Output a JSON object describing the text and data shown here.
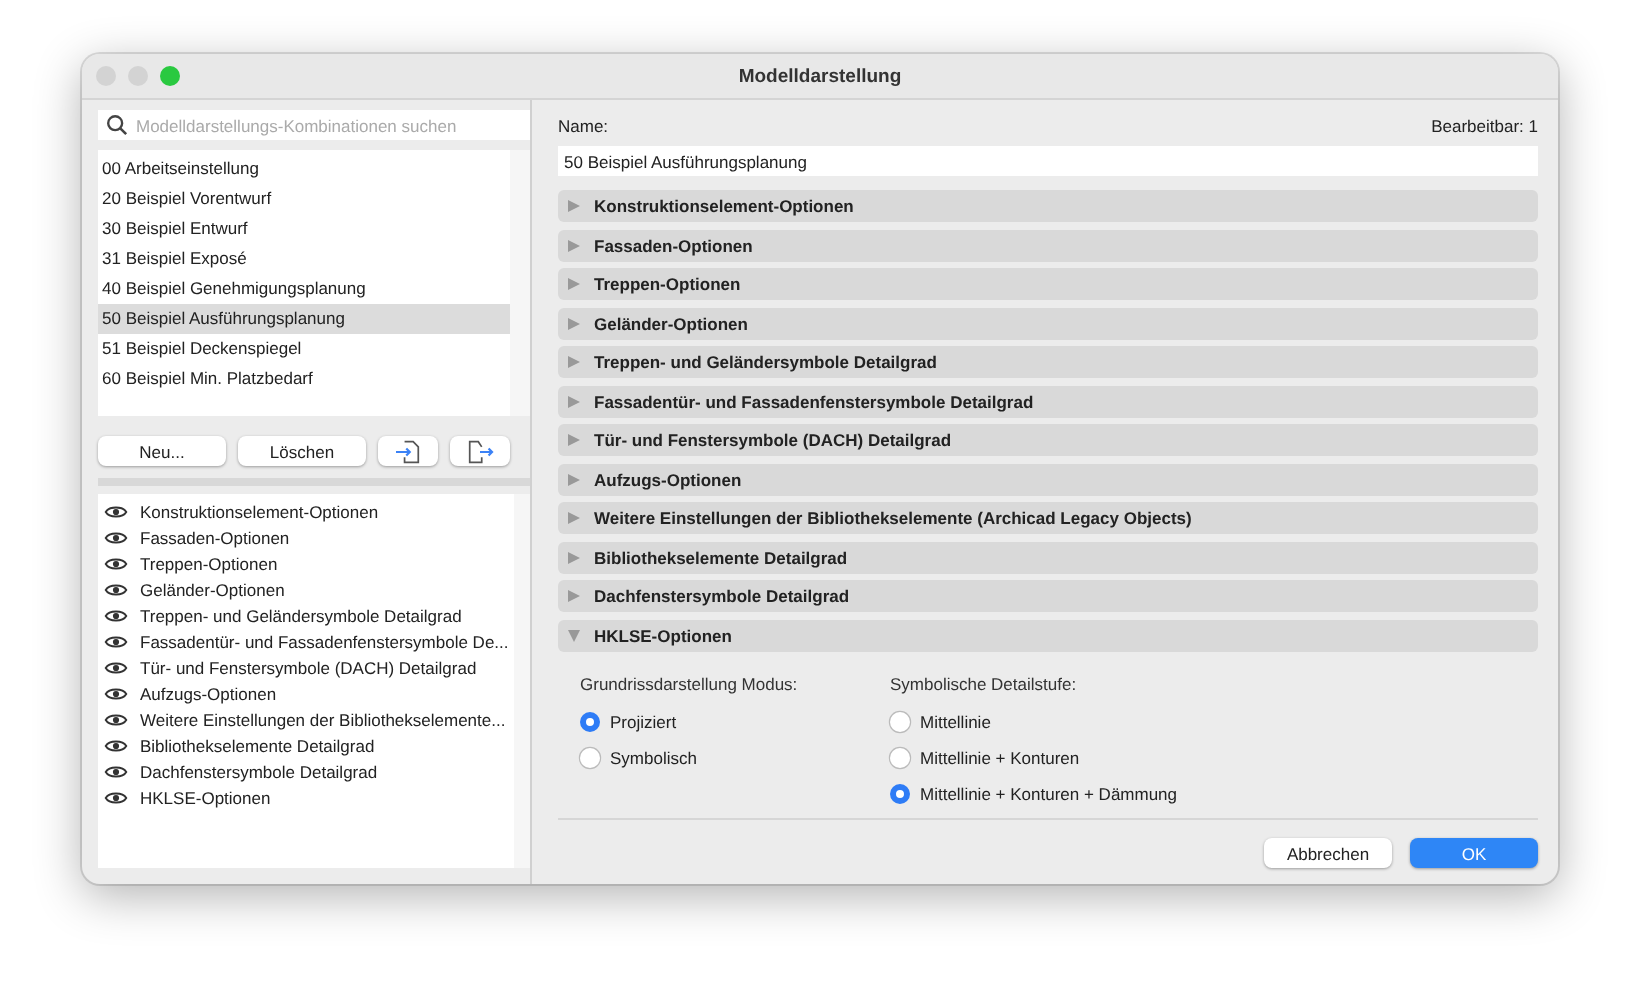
{
  "window": {
    "title": "Modelldarstellung"
  },
  "search": {
    "placeholder": "Modelldarstellungs-Kombinationen suchen"
  },
  "presets": [
    {
      "label": "00 Arbeitseinstellung",
      "selected": false
    },
    {
      "label": "20 Beispiel Vorentwurf",
      "selected": false
    },
    {
      "label": "30 Beispiel Entwurf",
      "selected": false
    },
    {
      "label": "31 Beispiel Exposé",
      "selected": false
    },
    {
      "label": "40 Beispiel Genehmigungsplanung",
      "selected": false
    },
    {
      "label": "50 Beispiel Ausführungsplanung",
      "selected": true
    },
    {
      "label": "51 Beispiel Deckenspiegel",
      "selected": false
    },
    {
      "label": "60 Beispiel Min. Platzbedarf",
      "selected": false
    }
  ],
  "preset_buttons": [
    "Neu...",
    "Löschen"
  ],
  "visible_options": [
    {
      "label": "Konstruktionselement-Optionen"
    },
    {
      "label": "Fassaden-Optionen"
    },
    {
      "label": "Treppen-Optionen"
    },
    {
      "label": "Geländer-Optionen"
    },
    {
      "label": "Treppen- und Geländersymbole Detailgrad"
    },
    {
      "label": "Fassadentür- und Fassadenfenstersymbole De..."
    },
    {
      "label": "Tür- und Fenstersymbole (DACH) Detailgrad"
    },
    {
      "label": "Aufzugs-Optionen"
    },
    {
      "label": "Weitere Einstellungen der Bibliothekselemente..."
    },
    {
      "label": "Bibliothekselemente Detailgrad"
    },
    {
      "label": "Dachfenstersymbole Detailgrad"
    },
    {
      "label": "HKLSE-Optionen"
    }
  ],
  "name": {
    "label": "Name:",
    "value": "50 Beispiel Ausführungsplanung"
  },
  "editable": "Bearbeitbar: 1",
  "sections": [
    {
      "label": "Konstruktionselement-Optionen",
      "expanded": false
    },
    {
      "label": "Fassaden-Optionen",
      "expanded": false
    },
    {
      "label": "Treppen-Optionen",
      "expanded": false
    },
    {
      "label": "Geländer-Optionen",
      "expanded": false
    },
    {
      "label": "Treppen- und Geländersymbole Detailgrad",
      "expanded": false
    },
    {
      "label": "Fassadentür- und Fassadenfenstersymbole Detailgrad",
      "expanded": false
    },
    {
      "label": "Tür- und Fenstersymbole (DACH) Detailgrad",
      "expanded": false
    },
    {
      "label": "Aufzugs-Optionen",
      "expanded": false
    },
    {
      "label": "Weitere Einstellungen der Bibliothekselemente (Archicad Legacy Objects)",
      "expanded": false
    },
    {
      "label": "Bibliothekselemente Detailgrad",
      "expanded": false
    },
    {
      "label": "Dachfenstersymbole Detailgrad",
      "expanded": false
    },
    {
      "label": "HKLSE-Optionen",
      "expanded": true,
      "groups": [
        {
          "label": "Grundrissdarstellung Modus:",
          "options": [
            {
              "label": "Projiziert",
              "selected": true
            },
            {
              "label": "Symbolisch",
              "selected": false
            }
          ]
        },
        {
          "label": "Symbolische Detailstufe:",
          "options": [
            {
              "label": "Mittellinie",
              "selected": false
            },
            {
              "label": "Mittellinie + Konturen",
              "selected": false
            },
            {
              "label": "Mittellinie + Konturen + Dämmung",
              "selected": true
            }
          ]
        }
      ]
    }
  ],
  "footer_buttons": [
    {
      "label": "Abbrechen",
      "kind": "secondary"
    },
    {
      "label": "OK",
      "kind": "primary"
    }
  ]
}
